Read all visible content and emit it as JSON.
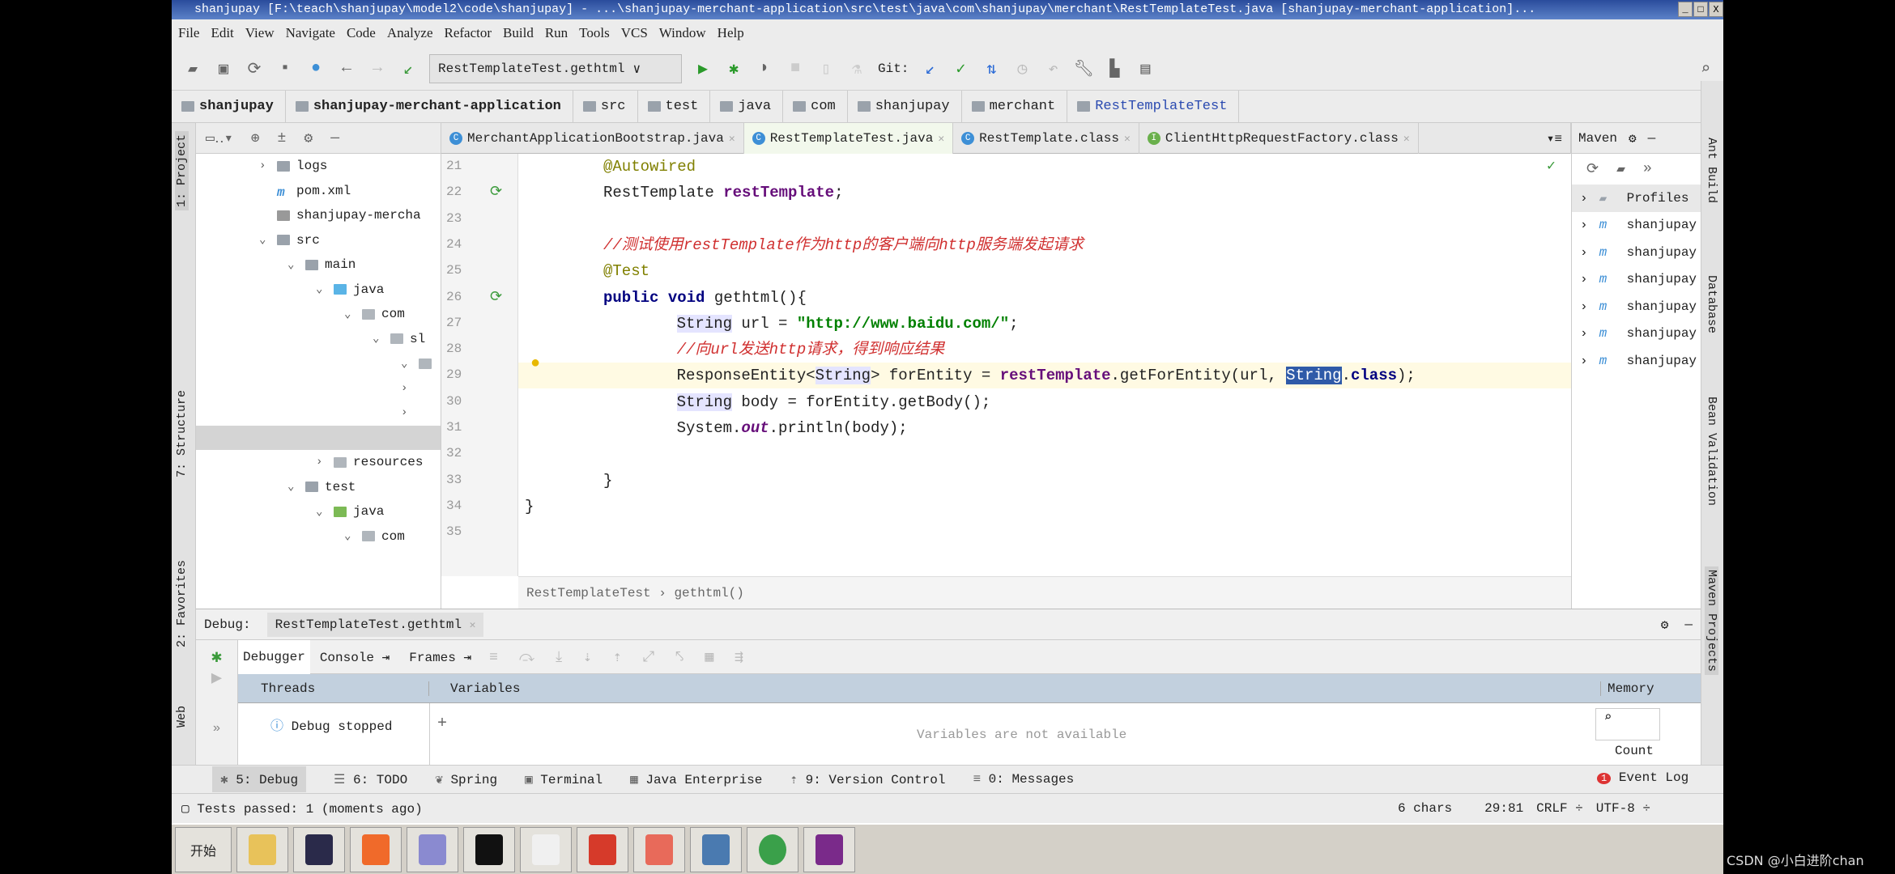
{
  "window": {
    "title": "shanjupay [F:\\teach\\shanjupay\\model2\\code\\shanjupay] - ...\\shanjupay-merchant-application\\src\\test\\java\\com\\shanjupay\\merchant\\RestTemplateTest.java [shanjupay-merchant-application]..."
  },
  "menu": [
    "File",
    "Edit",
    "View",
    "Navigate",
    "Code",
    "Analyze",
    "Refactor",
    "Build",
    "Run",
    "Tools",
    "VCS",
    "Window",
    "Help"
  ],
  "toolbar": {
    "run_config": "RestTemplateTest.gethtml",
    "git_label": "Git:"
  },
  "breadcrumb": [
    "shanjupay",
    "shanjupay-merchant-application",
    "src",
    "test",
    "java",
    "com",
    "shanjupay",
    "merchant",
    "RestTemplateTest"
  ],
  "left_strip": [
    "1: Project",
    "7: Structure",
    "2: Favorites",
    "Web"
  ],
  "project_tree": [
    {
      "label": "logs",
      "level": 0,
      "chev": ">",
      "icon": "folder"
    },
    {
      "label": "pom.xml",
      "level": 0,
      "chev": "",
      "icon": "maven"
    },
    {
      "label": "shanjupay-mercha",
      "level": 0,
      "chev": "",
      "icon": "file"
    },
    {
      "label": "src",
      "level": 0,
      "chev": "v",
      "icon": "folder"
    },
    {
      "label": "main",
      "level": 1,
      "chev": "v",
      "icon": "folder"
    },
    {
      "label": "java",
      "level": 2,
      "chev": "v",
      "icon": "folder-blue"
    },
    {
      "label": "com",
      "level": 3,
      "chev": "v",
      "icon": "package"
    },
    {
      "label": "sl",
      "level": 4,
      "chev": "v",
      "icon": "package"
    },
    {
      "label": "",
      "level": 5,
      "chev": "v",
      "icon": "package"
    },
    {
      "label": "",
      "level": 5,
      "chev": ">",
      "icon": ""
    },
    {
      "label": "",
      "level": 5,
      "chev": ">",
      "icon": ""
    },
    {
      "label": "",
      "level": 0,
      "chev": "",
      "icon": ""
    },
    {
      "label": "resources",
      "level": 2,
      "chev": ">",
      "icon": "folder-res"
    },
    {
      "label": "test",
      "level": 1,
      "chev": "v",
      "icon": "folder"
    },
    {
      "label": "java",
      "level": 2,
      "chev": "v",
      "icon": "folder-green"
    },
    {
      "label": "com",
      "level": 3,
      "chev": "v",
      "icon": "package"
    }
  ],
  "editor_tabs": [
    {
      "label": "MerchantApplicationBootstrap.java",
      "active": false
    },
    {
      "label": "RestTemplateTest.java",
      "active": true
    },
    {
      "label": "RestTemplate.class",
      "active": false
    },
    {
      "label": "ClientHttpRequestFactory.class",
      "active": false
    }
  ],
  "code_lines": [
    {
      "num": "21",
      "tokens": [
        {
          "t": "@Autowired",
          "c": "ann"
        }
      ]
    },
    {
      "num": "22",
      "tokens": [
        {
          "t": "RestTemplate ",
          "c": ""
        },
        {
          "t": "restTemplate",
          "c": "fld"
        },
        {
          "t": ";",
          "c": ""
        }
      ]
    },
    {
      "num": "23",
      "tokens": []
    },
    {
      "num": "24",
      "tokens": [
        {
          "t": "//测试使用restTemplate作为http的客户端向http服务端发起请求",
          "c": "cm"
        }
      ]
    },
    {
      "num": "25",
      "tokens": [
        {
          "t": "@Test",
          "c": "ann"
        }
      ]
    },
    {
      "num": "26",
      "tokens": [
        {
          "t": "public void ",
          "c": "kw"
        },
        {
          "t": "gethtml(){",
          "c": ""
        }
      ]
    },
    {
      "num": "27",
      "tokens": [
        {
          "t": "    ",
          "c": ""
        },
        {
          "t": "String",
          "c": "hl"
        },
        {
          "t": " url = ",
          "c": ""
        },
        {
          "t": "\"http://www.baidu.com/\"",
          "c": "str"
        },
        {
          "t": ";",
          "c": ""
        }
      ]
    },
    {
      "num": "28",
      "tokens": [
        {
          "t": "    ",
          "c": ""
        },
        {
          "t": "//向url发送http请求，得到响应结果",
          "c": "cm"
        }
      ]
    },
    {
      "num": "29",
      "tokens": [
        {
          "t": "    ResponseEntity<",
          "c": ""
        },
        {
          "t": "String",
          "c": "hl"
        },
        {
          "t": "> forEntity = ",
          "c": ""
        },
        {
          "t": "restTemplate",
          "c": "fld"
        },
        {
          "t": ".getForEntity(url, ",
          "c": ""
        },
        {
          "t": "String",
          "c": "sel"
        },
        {
          "t": ".",
          "c": ""
        },
        {
          "t": "class",
          "c": "kw"
        },
        {
          "t": ");",
          "c": ""
        }
      ],
      "current": true
    },
    {
      "num": "30",
      "tokens": [
        {
          "t": "    ",
          "c": ""
        },
        {
          "t": "String",
          "c": "hl"
        },
        {
          "t": " body = forEntity.getBody();",
          "c": ""
        }
      ]
    },
    {
      "num": "31",
      "tokens": [
        {
          "t": "    System.",
          "c": ""
        },
        {
          "t": "out",
          "c": "ital"
        },
        {
          "t": ".println(body);",
          "c": ""
        }
      ]
    },
    {
      "num": "32",
      "tokens": []
    },
    {
      "num": "33",
      "tokens": [
        {
          "t": "}",
          "c": ""
        }
      ]
    },
    {
      "num": "34",
      "tokens": [
        {
          "t": "}",
          "c": ""
        }
      ]
    },
    {
      "num": "35",
      "tokens": []
    }
  ],
  "editor_breadcrumb": [
    "RestTemplateTest",
    "gethtml()"
  ],
  "maven": {
    "title": "Maven",
    "items": [
      "Profiles",
      "shanjupay",
      "shanjupay",
      "shanjupay",
      "shanjupay",
      "shanjupay",
      "shanjupay"
    ]
  },
  "right_strip": [
    "Ant Build",
    "Database",
    "Bean Validation",
    "Maven Projects"
  ],
  "debug": {
    "label": "Debug:",
    "session": "RestTemplateTest.gethtml",
    "tabs": [
      "Debugger",
      "Console",
      "Frames"
    ],
    "threads": "Threads",
    "variables": "Variables",
    "thread_status": "Debug stopped",
    "variables_empty": "Variables are not available",
    "memory": "Memory",
    "count": "Count"
  },
  "bottom_tabs": [
    "5: Debug",
    "6: TODO",
    "Spring",
    "Terminal",
    "Java Enterprise",
    "9: Version Control",
    "0: Messages"
  ],
  "event_log": {
    "label": "Event Log",
    "count": "1"
  },
  "status": {
    "message": "Tests passed: 1 (moments ago)",
    "chars": "6 chars",
    "position": "29:81",
    "line_sep": "CRLF ÷",
    "encoding": "UTF-8 ÷"
  },
  "taskbar": {
    "start": "开始",
    "icons": [
      "explorer",
      "intellij",
      "postman",
      "typora",
      "cmd",
      "text",
      "redis",
      "app",
      "network",
      "chrome",
      "pdf"
    ]
  },
  "watermark": "CSDN @小白进阶chan",
  "colors": {
    "keyword": "#000080",
    "annotation": "#808000",
    "field": "#660e7a",
    "string": "#008000",
    "comment": "#d03030",
    "selection": "#2f5aa8",
    "current_line": "#fffae3"
  }
}
